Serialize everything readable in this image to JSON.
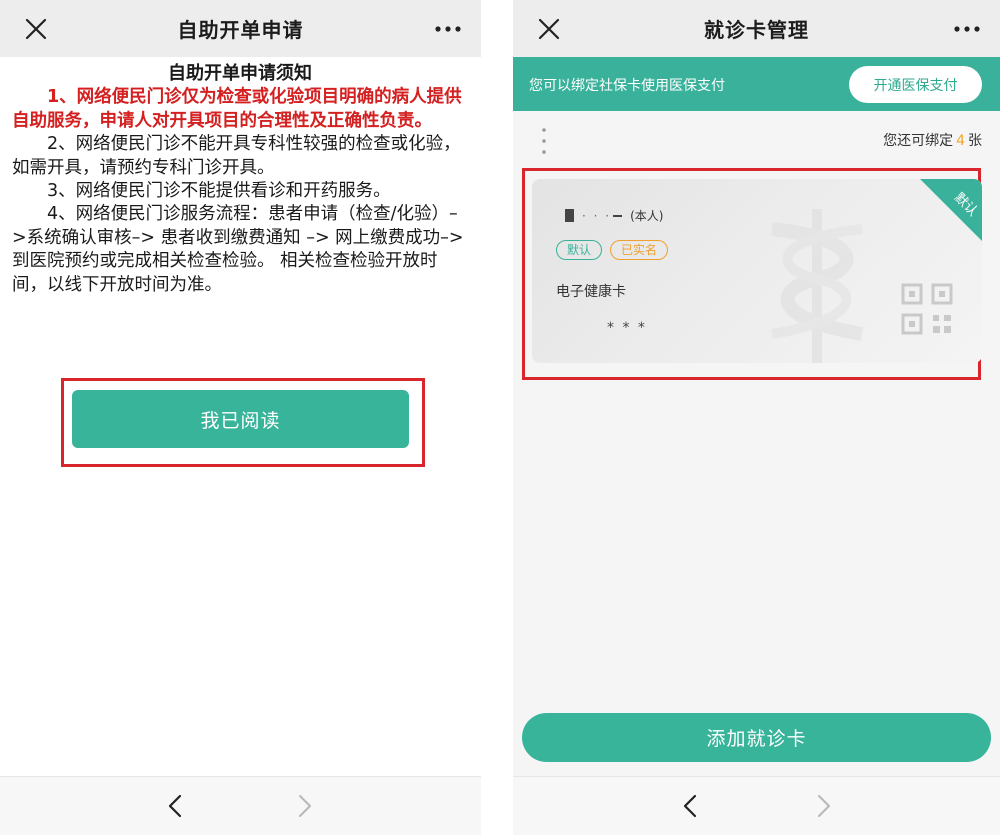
{
  "left": {
    "header": {
      "title": "自助开单申请"
    },
    "notice": {
      "title": "自助开单申请须知",
      "paragraphs": [
        "1、网络便民门诊仅为检查或化验项目明确的病人提供自助服务，申请人对开具项目的合理性及正确性负责。",
        "2、网络便民门诊不能开具专科性较强的检查或化验，如需开具，请预约专科门诊开具。",
        "3、网络便民门诊不能提供看诊和开药服务。",
        "4、网络便民门诊服务流程：患者申请（检查/化验）–>系统确认审核–> 患者收到缴费通知 –> 网上缴费成功–> 到医院预约或完成相关检查检验。 相关检查检验开放时间，以线下开放时间为准。"
      ]
    },
    "read_button": "我已阅读"
  },
  "right": {
    "header": {
      "title": "就诊卡管理"
    },
    "banner": {
      "text": "您可以绑定社保卡使用医保支付",
      "button": "开通医保支付"
    },
    "bind_count": {
      "prefix": "您还可绑定",
      "count": "4",
      "suffix": "张"
    },
    "card": {
      "ribbon": "默认",
      "name_masked_dots": "· · ·",
      "relation": "(本人)",
      "tags": [
        "默认",
        "已实名"
      ],
      "type": "电子健康卡",
      "number_masked": "* * *"
    },
    "add_button": "添加就诊卡"
  },
  "colors": {
    "accent": "#37b49a",
    "warning_text": "#d42020",
    "highlight_border": "#d9262c",
    "verified_tag": "#f0a030",
    "count_number": "#f5a623"
  },
  "icons": {
    "close": "close-icon",
    "more": "more-icon",
    "back": "back-icon",
    "forward": "forward-icon",
    "qr": "qr-code-icon"
  }
}
